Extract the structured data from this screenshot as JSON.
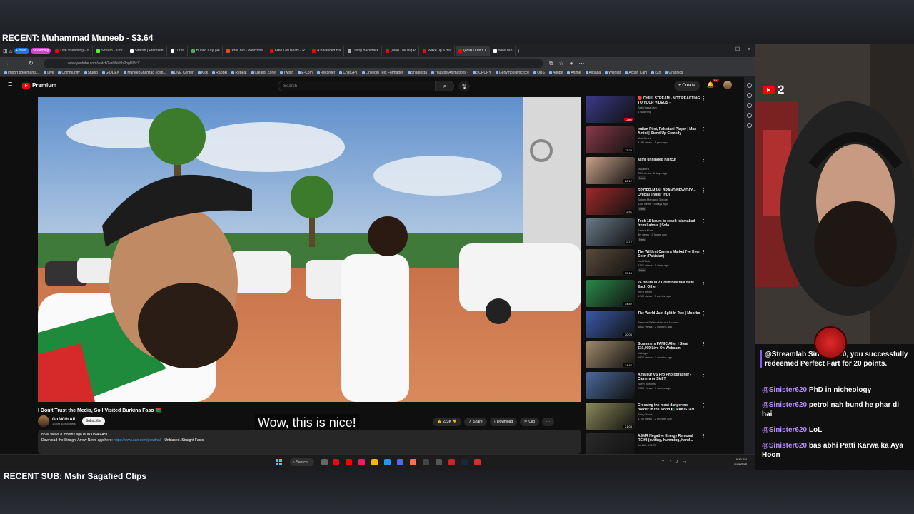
{
  "overlay": {
    "recent_tip": "RECENT: Muhammad Muneeb - $3.64",
    "recent_sub": "RECENT SUB: Mshr Sagafied Clips",
    "yt_viewers": "2"
  },
  "browser": {
    "tabs": [
      {
        "label": "Live streaming - Y",
        "color": "#ff0000"
      },
      {
        "label": "Stream - Kick",
        "color": "#53fc18"
      },
      {
        "label": "Sitarah | Premium",
        "color": "#ffffff"
      },
      {
        "label": "Lurkit",
        "color": "#ffffff"
      },
      {
        "label": "Buried City | Al",
        "color": "#4caf50"
      },
      {
        "label": "ProChat - Welcome",
        "color": "#e34c26"
      },
      {
        "label": "Free Lofi Beats - R",
        "color": "#ff0000"
      },
      {
        "label": "A Balanced Ha",
        "color": "#ff0000"
      },
      {
        "label": "Using Backtrack",
        "color": "#aaaaaa"
      },
      {
        "label": "(864) The Big P",
        "color": "#ff0000"
      },
      {
        "label": "Wake up a dev",
        "color": "#ff0000"
      },
      {
        "label": "(459) I Don't T",
        "color": "#ff0000"
      },
      {
        "label": "New Tab",
        "color": "#ffffff"
      }
    ],
    "group_pills": [
      "Emails",
      "Streaming"
    ],
    "window_controls": [
      "—",
      "☐",
      "✕"
    ],
    "url": "www.youtube.com/watch?v=90iuhhPpgUlBcY",
    "bookmarks": [
      "Import bookmarks...",
      "Live",
      "Community",
      "Studio",
      "GIDDEN",
      "MuneebShahzad (@m...",
      "LIVE Center",
      "Kick",
      "RapBR",
      "Repeat",
      "Creator Zone",
      "Twitch",
      "E-Com",
      "Recorder",
      "ChatGPT",
      "LinkedIn Text Formatter",
      "Snapinsta",
      "Youtube Animations -",
      "SCRCPY",
      "Genymobile/scrcpy",
      "OBS",
      "Adobe",
      "Anime",
      "Alibaba",
      "Wishlist",
      "Action Cam",
      "c2o",
      "Graphics"
    ]
  },
  "youtube": {
    "logo_text": "Premium",
    "search_placeholder": "Search",
    "create_label": "Create",
    "notif_count": "9+",
    "video_title": "I Don't Trust the Media, So I Visited Burkina Faso 🇧🇫",
    "caption": "Wow, this is nice!",
    "channel_name": "Go With Ali",
    "channel_subs": "1.55M subscribers",
    "subscribe_label": "Subscribe",
    "actions": {
      "likes": "223K",
      "share": "Share",
      "download": "Download",
      "clip": "Clip"
    },
    "description": {
      "meta": "8.9M views  8 months ago  BURKINA FASO",
      "text": "Download the Straight Arrow News app here: ",
      "link": "https://www.san.com/gowithali",
      "tail": " - Unbiased. Straight Facts."
    },
    "recommendations": [
      {
        "title": "🔴 CHILL STREAM - NOT REACTING TO YOUR VIDEOS -",
        "channel": "BabuYaga Live",
        "meta": "1 watching",
        "badge": "LIVE",
        "new": "",
        "thumb": "#3a3a8a"
      },
      {
        "title": "Indian Pilot, Pakistani Player | Max Amini | Stand Up Comedy",
        "channel": "Max Amini",
        "meta": "3.2M views · 1 year ago",
        "badge": "13:24",
        "new": "",
        "thumb": "#8a3a4a"
      },
      {
        "title": "asmr unhinged haircut",
        "channel": "razpberrt",
        "meta": "35K views · 6 days ago",
        "badge": "26:12",
        "new": "New",
        "thumb": "#c9a28a"
      },
      {
        "title": "SPIDER-MAN: BRAND NEW DAY – Official Trailer (HD)",
        "channel": "Spider-Man and 3 more",
        "meta": "12M views · 5 days ago",
        "badge": "2:41",
        "new": "New",
        "thumb": "#a02a2a"
      },
      {
        "title": "Took 15 hours to reach Islamabad from Lahore | Solo ...",
        "channel": "Banna Khan",
        "meta": "3K views · 3 hours ago",
        "badge": "9:17",
        "new": "New",
        "thumb": "#6a7a8a"
      },
      {
        "title": "The Wildest Camera Market I've Ever Seen (Pakistan)",
        "channel": "Karl Rock",
        "meta": "216K views · 5 days ago",
        "badge": "30:13",
        "new": "New",
        "thumb": "#5a4a3a"
      },
      {
        "title": "24 Hours in 2 Countries that Hate Each Other",
        "channel": "Tim Theory",
        "meta": "1.5M views · 3 weeks ago",
        "badge": "34:42",
        "new": "",
        "thumb": "#2a8a4a"
      },
      {
        "title": "The World Just Split In Two | Moorbo",
        "channel": "Taimoor Salahuddin aka Mooroo",
        "meta": "486K views · 2 months ago",
        "badge": "20:05",
        "new": "",
        "thumb": "#3a5aaa"
      },
      {
        "title": "Scammers PANIC After I Steal $10,000 Live On Webcam!",
        "channel": "Kitboga",
        "meta": "982K views · 3 months ago",
        "badge": "14:47",
        "new": "",
        "thumb": "#a08a6a"
      },
      {
        "title": "Amateur VS Pro Photographer - Camera or Skill?",
        "channel": "North Borders",
        "meta": "295K views · 3 weeks ago",
        "badge": "",
        "new": "",
        "thumb": "#4a6a9a"
      },
      {
        "title": "Crossing the most dangerous border in the world 🇵🇰 PAKISTAN...",
        "channel": "Ruhy Boots",
        "meta": "4.1M views · 2 months ago",
        "badge": "21:03",
        "new": "",
        "thumb": "#8a8a5a"
      },
      {
        "title": "ASMR Negative Energy Removal REIKI (cutting, humming, hand...",
        "channel": "darkiite ASMR",
        "meta": "",
        "badge": "",
        "new": "",
        "thumb": "#2a2a2a"
      }
    ]
  },
  "taskbar": {
    "search_label": "Search",
    "time": "9:43 PM",
    "date": "3/23/2026"
  },
  "chat": {
    "redeem": {
      "user": "@Streamlab",
      "text": "Sinister620, you successfully redeemed Perfect Fart for 20 points."
    },
    "messages": [
      {
        "user": "@Sinister620",
        "text": "PhD in nicheology"
      },
      {
        "user": "@Sinister620",
        "text": "petrol nah bund he phar di hai"
      },
      {
        "user": "@Sinister620",
        "text": "LoL"
      },
      {
        "user": "@Sinister620",
        "text": "bas abhi Patti Karwa ka Aya Hoon"
      }
    ]
  }
}
